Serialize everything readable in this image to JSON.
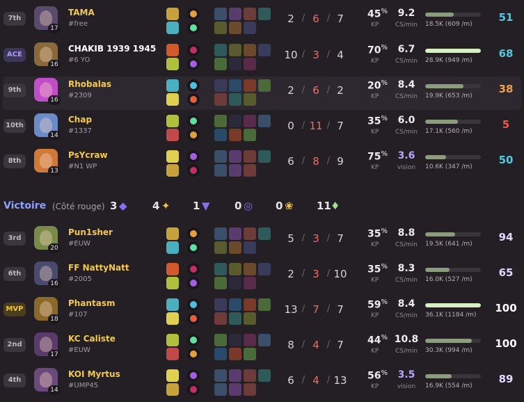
{
  "team_top": [
    {
      "rank": "7th",
      "name": "TAMA",
      "tag": "#free",
      "level": "17",
      "k": "2",
      "d": "6",
      "a": "7",
      "kp": "45",
      "cs": "9.2",
      "cs_label": "CS/min",
      "dmg": "18.5K (609 /m)",
      "dmg_frac": 0.51,
      "score": "51",
      "score_color": "#4fc9e0",
      "portrait": "#5a4a6e"
    },
    {
      "rank": "ACE",
      "name": "CHAKIB 1939 1945",
      "tag": "#6 YO",
      "level": "16",
      "k": "10",
      "d": "3",
      "a": "4",
      "kp": "70",
      "cs": "6.7",
      "cs_label": "CS/min",
      "dmg": "28.9K (949 /m)",
      "dmg_frac": 1.0,
      "score": "68",
      "score_color": "#4fc9e0",
      "portrait": "#8a6a3a"
    },
    {
      "rank": "9th",
      "name": "Rhobalas",
      "tag": "#2309",
      "level": "16",
      "k": "2",
      "d": "6",
      "a": "2",
      "kp": "20",
      "cs": "8.4",
      "cs_label": "CS/min",
      "dmg": "19.9K (653 /m)",
      "dmg_frac": 0.69,
      "score": "38",
      "score_color": "#f0a050",
      "portrait": "#c04ec8"
    },
    {
      "rank": "10th",
      "name": "Chap",
      "tag": "#1337",
      "level": "14",
      "k": "0",
      "d": "11",
      "a": "7",
      "kp": "35",
      "cs": "6.0",
      "cs_label": "CS/min",
      "dmg": "17.1K (560 /m)",
      "dmg_frac": 0.59,
      "score": "5",
      "score_color": "#ee5a4a",
      "portrait": "#6a8ac8"
    },
    {
      "rank": "8th",
      "name": "PsYcraw",
      "tag": "#N1 WP",
      "level": "13",
      "k": "6",
      "d": "8",
      "a": "9",
      "kp": "75",
      "cs": "3.6",
      "cs_label": "vision",
      "dmg": "10.6K (347 /m)",
      "dmg_frac": 0.37,
      "score": "50",
      "score_color": "#4fc9e0",
      "portrait": "#d07a3a"
    }
  ],
  "separator": {
    "result": "Victoire",
    "side": "(Côté rouge)",
    "objectives": [
      {
        "value": "3",
        "icon": "tower-icon",
        "color": "#8a6ff0"
      },
      {
        "value": "4",
        "icon": "dragon-icon",
        "color": "#f1c540"
      },
      {
        "value": "1",
        "icon": "baron-icon",
        "color": "#8a6ff0"
      },
      {
        "value": "0",
        "icon": "herald-icon",
        "color": "#8a6ff0"
      },
      {
        "value": "0",
        "icon": "grub-icon",
        "color": "#f1c540"
      },
      {
        "value": "11",
        "icon": "kill-icon",
        "color": "#9fe08a"
      }
    ]
  },
  "team_bottom": [
    {
      "rank": "3rd",
      "name": "Pun1sher",
      "tag": "#EUW",
      "level": "20",
      "k": "5",
      "d": "3",
      "a": "7",
      "kp": "35",
      "cs": "8.8",
      "cs_label": "CS/min",
      "dmg": "19.5K (641 /m)",
      "dmg_frac": 0.54,
      "score": "94",
      "score_color": "#e0d8ff",
      "portrait": "#7a8a4a"
    },
    {
      "rank": "6th",
      "name": "FF NattyNatt",
      "tag": "#2005",
      "level": "16",
      "k": "2",
      "d": "3",
      "a": "10",
      "kp": "35",
      "cs": "8.3",
      "cs_label": "CS/min",
      "dmg": "16.0K (527 /m)",
      "dmg_frac": 0.44,
      "score": "65",
      "score_color": "#e0d8ff",
      "portrait": "#4a4a6e"
    },
    {
      "rank": "MVP",
      "name": "Phantasm",
      "tag": "#107",
      "level": "18",
      "k": "13",
      "d": "7",
      "a": "7",
      "kp": "59",
      "cs": "8.4",
      "cs_label": "CS/min",
      "dmg": "36.1K (1184 /m)",
      "dmg_frac": 1.0,
      "score": "100",
      "score_color": "#ffffff",
      "portrait": "#8a6a2a"
    },
    {
      "rank": "2nd",
      "name": "KC Caliste",
      "tag": "#EUW",
      "level": "17",
      "k": "8",
      "d": "4",
      "a": "7",
      "kp": "44",
      "cs": "10.8",
      "cs_label": "CS/min",
      "dmg": "30.3K (994 /m)",
      "dmg_frac": 0.84,
      "score": "100",
      "score_color": "#ffffff",
      "portrait": "#5a3a6a"
    },
    {
      "rank": "4th",
      "name": "KOI Myrtus",
      "tag": "#UMP45",
      "level": "14",
      "k": "6",
      "d": "4",
      "a": "13",
      "kp": "56",
      "cs": "3.5",
      "cs_label": "vision",
      "dmg": "16.9K (554 /m)",
      "dmg_frac": 0.47,
      "score": "89",
      "score_color": "#e0d8ff",
      "portrait": "#6a4a7a"
    }
  ],
  "labels": {
    "kp": "KP",
    "kp_unit": "%"
  }
}
